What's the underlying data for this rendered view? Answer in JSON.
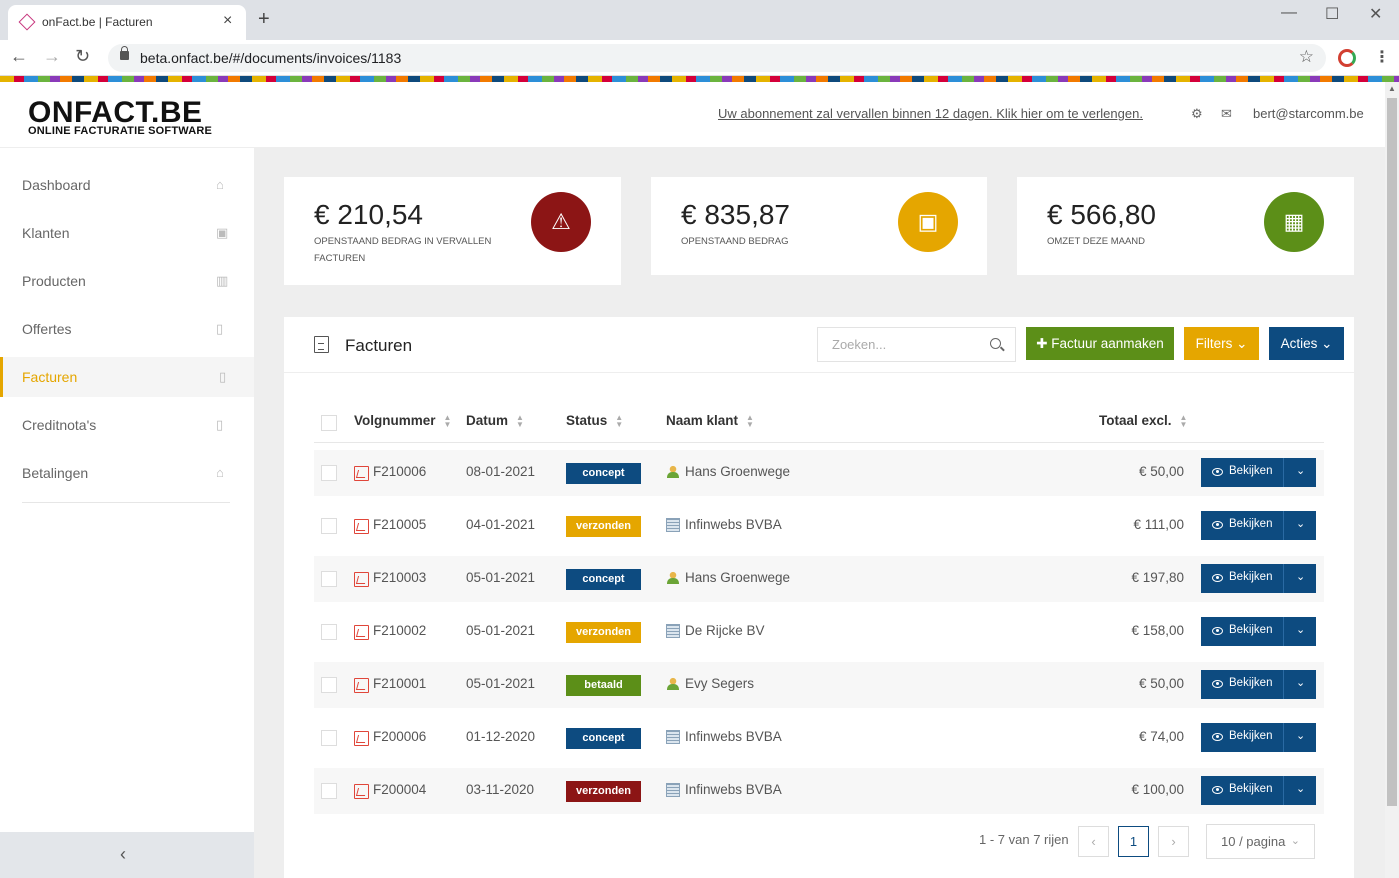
{
  "browser": {
    "tab_title": "onFact.be | Facturen",
    "url": "beta.onfact.be/#/documents/invoices/1183"
  },
  "header": {
    "logo": "ONFACT.BE",
    "logo_sub": "ONLINE FACTURATIE SOFTWARE",
    "renew_notice": "Uw abonnement zal vervallen binnen 12 dagen. Klik hier om te verlengen.",
    "user_email": "bert@starcomm.be"
  },
  "sidebar": {
    "items": [
      {
        "label": "Dashboard",
        "icon": "home-icon"
      },
      {
        "label": "Klanten",
        "icon": "contacts-icon"
      },
      {
        "label": "Producten",
        "icon": "barcode-icon"
      },
      {
        "label": "Offertes",
        "icon": "pdf-icon"
      },
      {
        "label": "Facturen",
        "icon": "pdf-icon"
      },
      {
        "label": "Creditnota's",
        "icon": "pdf-icon"
      },
      {
        "label": "Betalingen",
        "icon": "bank-icon"
      }
    ],
    "active": "Facturen",
    "collapse": "‹"
  },
  "stats": [
    {
      "amount": "€ 210,54",
      "label": "OPENSTAAND BEDRAG IN VERVALLEN FACTUREN",
      "icon": "warning-icon",
      "color": "#8c1515"
    },
    {
      "amount": "€ 835,87",
      "label": "OPENSTAAND BEDRAG",
      "icon": "money-icon",
      "color": "#e5a600"
    },
    {
      "amount": "€ 566,80",
      "label": "OMZET DEZE MAAND",
      "icon": "calendar-icon",
      "color": "#5c8f18"
    }
  ],
  "invoices": {
    "title": "Facturen",
    "search_placeholder": "Zoeken...",
    "create_button": "Factuur aanmaken",
    "filters_button": "Filters",
    "actions_button": "Acties",
    "columns": [
      "Volgnummer",
      "Datum",
      "Status",
      "Naam klant",
      "Totaal excl."
    ],
    "rows": [
      {
        "number": "F210006",
        "date": "08-01-2021",
        "status": "concept",
        "status_color": "#0d4b80",
        "client": "Hans Groenwege",
        "client_type": "person",
        "total": "€ 50,00"
      },
      {
        "number": "F210005",
        "date": "04-01-2021",
        "status": "verzonden",
        "status_color": "#e5a600",
        "client": "Infinwebs BVBA",
        "client_type": "company",
        "total": "€ 111,00"
      },
      {
        "number": "F210003",
        "date": "05-01-2021",
        "status": "concept",
        "status_color": "#0d4b80",
        "client": "Hans Groenwege",
        "client_type": "person",
        "total": "€ 197,80"
      },
      {
        "number": "F210002",
        "date": "05-01-2021",
        "status": "verzonden",
        "status_color": "#e5a600",
        "client": "De Rijcke BV",
        "client_type": "company",
        "total": "€ 158,00"
      },
      {
        "number": "F210001",
        "date": "05-01-2021",
        "status": "betaald",
        "status_color": "#5c8f18",
        "client": "Evy Segers",
        "client_type": "person",
        "total": "€ 50,00"
      },
      {
        "number": "F200006",
        "date": "01-12-2020",
        "status": "concept",
        "status_color": "#0d4b80",
        "client": "Infinwebs BVBA",
        "client_type": "company",
        "total": "€ 74,00"
      },
      {
        "number": "F200004",
        "date": "03-11-2020",
        "status": "verzonden",
        "status_color": "#8c1515",
        "client": "Infinwebs BVBA",
        "client_type": "company",
        "total": "€ 100,00"
      }
    ],
    "row_button": "Bekijken",
    "pagination": {
      "info": "1 - 7 van 7 rijen",
      "current_page": "1",
      "per_page": "10 / pagina"
    }
  }
}
